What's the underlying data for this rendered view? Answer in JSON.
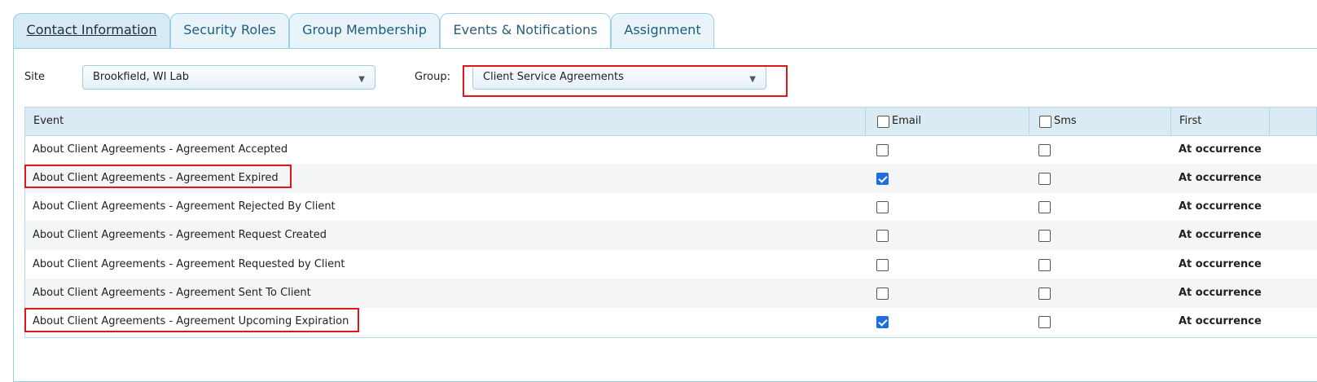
{
  "tabs": [
    {
      "label": "Contact Information",
      "active": false
    },
    {
      "label": "Security Roles",
      "active": false
    },
    {
      "label": "Group Membership",
      "active": false
    },
    {
      "label": "Events & Notifications",
      "active": true
    },
    {
      "label": "Assignment",
      "active": false
    }
  ],
  "filters": {
    "site_label": "Site",
    "site_value": "Brookfield, WI Lab",
    "group_label": "Group:",
    "group_value": "Client Service Agreements"
  },
  "grid": {
    "headers": {
      "event": "Event",
      "email": "Email",
      "sms": "Sms",
      "first": "First"
    },
    "rows": [
      {
        "event": "About Client Agreements - Agreement Accepted",
        "email": false,
        "sms": false,
        "first": "At occurrence"
      },
      {
        "event": "About Client Agreements - Agreement Expired",
        "email": true,
        "sms": false,
        "first": "At occurrence"
      },
      {
        "event": "About Client Agreements - Agreement Rejected By Client",
        "email": false,
        "sms": false,
        "first": "At occurrence"
      },
      {
        "event": "About Client Agreements - Agreement Request Created",
        "email": false,
        "sms": false,
        "first": "At occurrence"
      },
      {
        "event": "About Client Agreements - Agreement Requested by Client",
        "email": false,
        "sms": false,
        "first": "At occurrence"
      },
      {
        "event": "About Client Agreements - Agreement Sent To Client",
        "email": false,
        "sms": false,
        "first": "At occurrence"
      },
      {
        "event": "About Client Agreements - Agreement Upcoming Expiration",
        "email": true,
        "sms": false,
        "first": "At occurrence"
      }
    ]
  },
  "colors": {
    "accent": "#1a6c97",
    "checkbox_checked": "#1d6fe0",
    "highlight": "#e0161a"
  }
}
